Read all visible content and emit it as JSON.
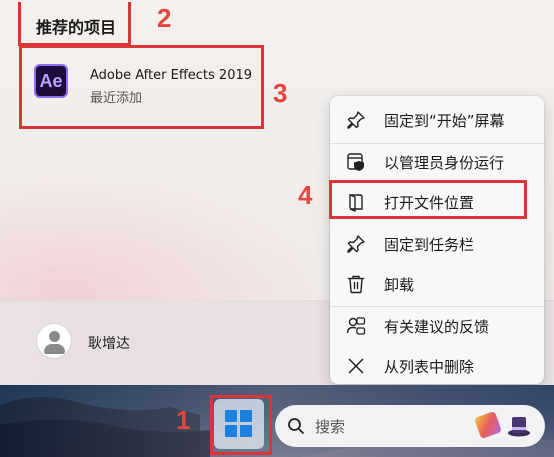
{
  "start_menu": {
    "recommended_title": "推荐的项目",
    "recommended_items": [
      {
        "icon_text": "Ae",
        "name": "Adobe After Effects 2019",
        "subtitle": "最近添加"
      }
    ],
    "user": {
      "name": "耿增达"
    }
  },
  "context_menu": {
    "items": [
      {
        "label": "固定到“开始”屏幕",
        "icon": "pin-icon"
      },
      {
        "label": "以管理员身份运行",
        "icon": "shield-admin-icon"
      },
      {
        "label": "打开文件位置",
        "icon": "folder-open-icon"
      },
      {
        "label": "固定到任务栏",
        "icon": "pin-icon"
      },
      {
        "label": "卸载",
        "icon": "trash-icon"
      },
      {
        "label": "有关建议的反馈",
        "icon": "feedback-icon"
      },
      {
        "label": "从列表中删除",
        "icon": "close-icon"
      }
    ]
  },
  "taskbar": {
    "search_placeholder": "搜索"
  },
  "annotations": [
    "1",
    "2",
    "3",
    "4"
  ],
  "colors": {
    "annotation": "#d9363a",
    "accent": "#1d7fe0",
    "ae_bg": "#1f0b3a",
    "ae_border": "#8d6cff"
  }
}
